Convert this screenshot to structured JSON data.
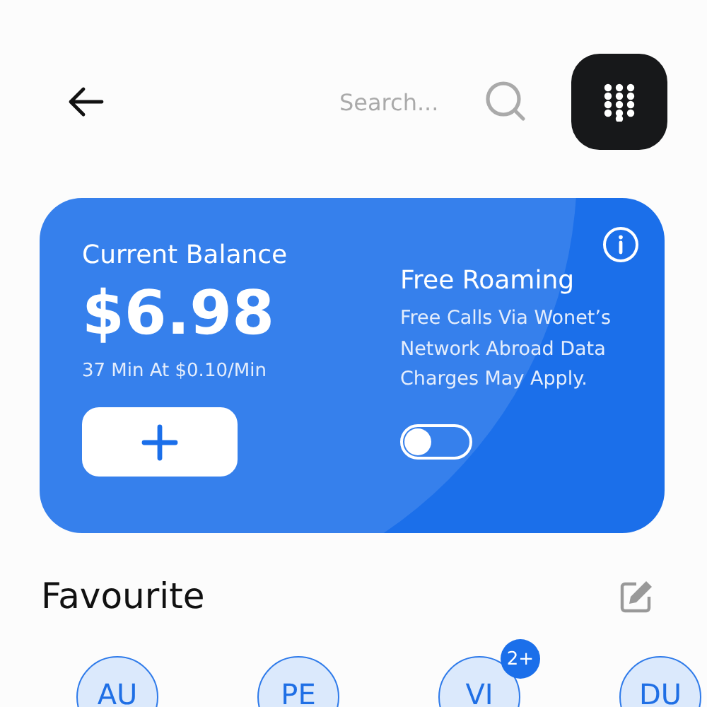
{
  "search": {
    "placeholder": "Search..."
  },
  "balance_card": {
    "title": "Current Balance",
    "amount": "$6.98",
    "detail": "37 Min At $0.10/Min"
  },
  "roaming": {
    "title": "Free Roaming",
    "description": "Free Calls Via Wonet’s Network Abroad Data Charges May Apply.",
    "on": false
  },
  "favourites": {
    "title": "Favourite",
    "contacts": [
      {
        "initials": "AU"
      },
      {
        "initials": "PE"
      },
      {
        "initials": "VI",
        "badge": "2+"
      },
      {
        "initials": "DU"
      }
    ]
  }
}
